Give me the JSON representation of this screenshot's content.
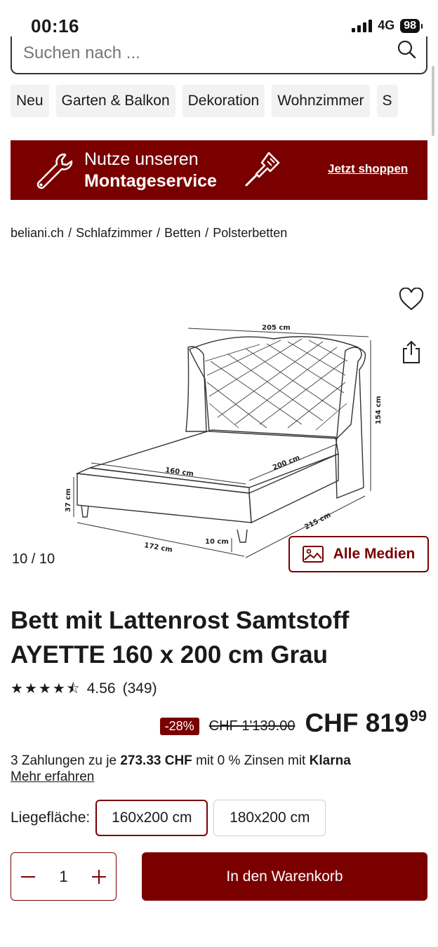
{
  "status_bar": {
    "time": "00:16",
    "network": "4G",
    "battery": "98"
  },
  "search": {
    "placeholder": "Suchen nach ..."
  },
  "categories": [
    "Neu",
    "Garten & Balkon",
    "Dekoration",
    "Wohnzimmer",
    "S"
  ],
  "banner": {
    "line1": "Nutze unseren",
    "line2": "Montageservice",
    "link": "Jetzt shoppen"
  },
  "breadcrumb": [
    "beliani.ch",
    "Schlafzimmer",
    "Betten",
    "Polsterbetten"
  ],
  "gallery": {
    "counter": "10 / 10",
    "media_button": "Alle Medien",
    "dimensions": {
      "width": "205 cm",
      "height": "154 cm",
      "mattress_width": "160 cm",
      "mattress_length": "200 cm",
      "total_length": "215 cm",
      "frame_width": "172 cm",
      "side_height": "37 cm",
      "leg_height": "10 cm"
    }
  },
  "product": {
    "title": "Bett mit Lattenrost Samtstoff AYETTE 160 x 200 cm Grau",
    "rating": "4.56",
    "reviews": "(349)",
    "discount": "-28%",
    "old_price": "CHF 1'139.00",
    "price_main": "CHF 819",
    "price_cents": "99",
    "installment_prefix": "3 Zahlungen zu je",
    "installment_amount": "273.33 CHF",
    "installment_suffix": "mit 0 % Zinsen mit",
    "klarna": "Klarna",
    "more_link": "Mehr erfahren"
  },
  "size": {
    "label": "Liegefläche:",
    "options": [
      "160x200 cm",
      "180x200 cm"
    ],
    "selected": "160x200 cm"
  },
  "quantity": "1",
  "cart_button": "In den Warenkorb",
  "colors": {
    "brand": "#7a0000"
  }
}
